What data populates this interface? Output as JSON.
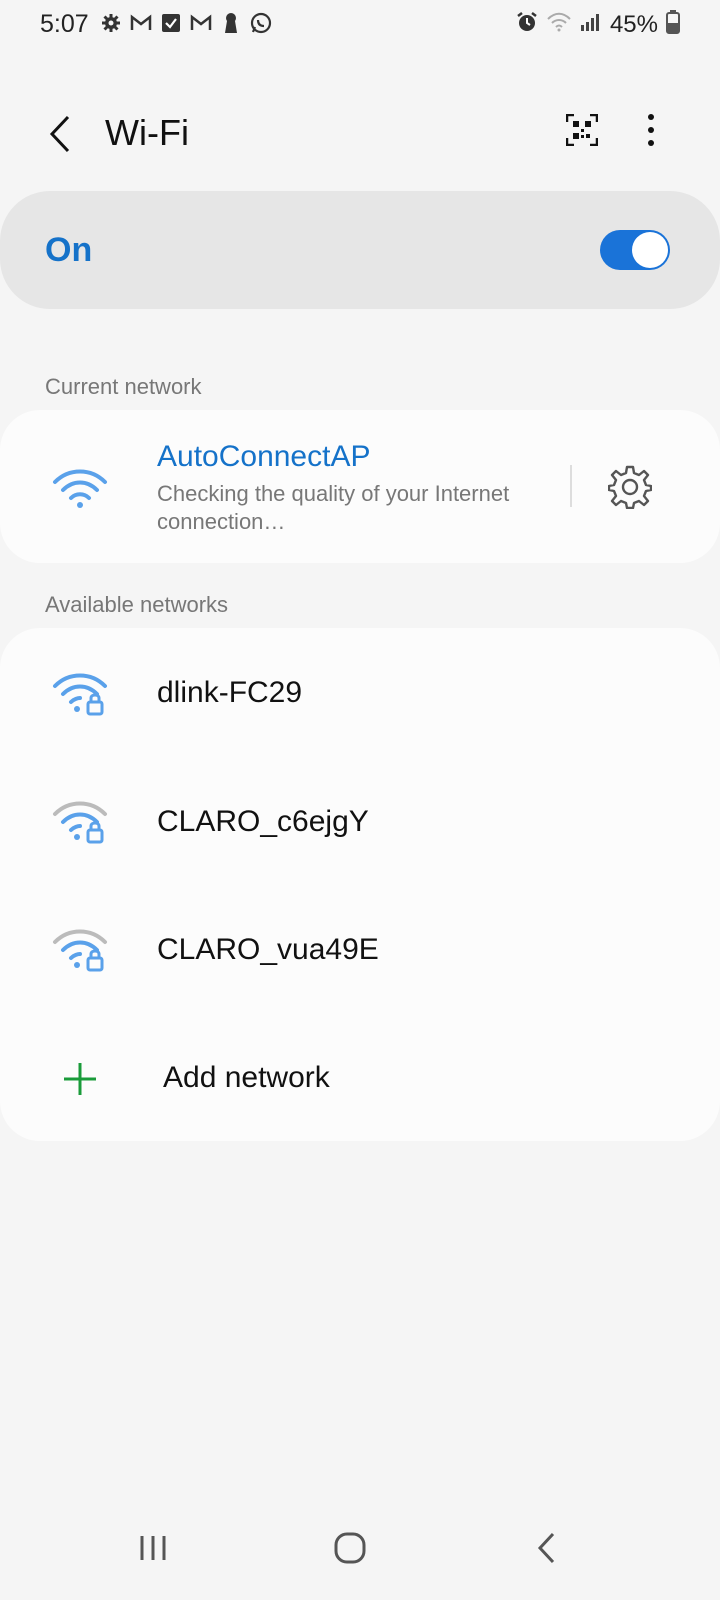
{
  "status_bar": {
    "time": "5:07",
    "battery": "45%",
    "left_icons": [
      "gear-icon",
      "gmail-icon",
      "checkbox-icon",
      "gmail-icon",
      "keyhole-icon",
      "whatsapp-icon"
    ],
    "right_icons": [
      "alarm-icon",
      "wifi-icon",
      "signal-icon",
      "battery-icon"
    ]
  },
  "header": {
    "title": "Wi-Fi"
  },
  "wifi_toggle": {
    "label": "On",
    "enabled": true
  },
  "current_network": {
    "section_label": "Current network",
    "name": "AutoConnectAP",
    "status": "Checking the quality of your Internet connection…"
  },
  "available_networks": {
    "section_label": "Available networks",
    "items": [
      {
        "name": "dlink-FC29",
        "secured": true,
        "strength": "full"
      },
      {
        "name": "CLARO_c6ejgY",
        "secured": true,
        "strength": "weak"
      },
      {
        "name": "CLARO_vua49E",
        "secured": true,
        "strength": "weak"
      }
    ],
    "add_label": "Add network"
  },
  "colors": {
    "accent": "#1572c9",
    "wifi_blue": "#5aa1ea",
    "wifi_gray": "#b9b9b9",
    "add_green": "#1a9b3a"
  }
}
